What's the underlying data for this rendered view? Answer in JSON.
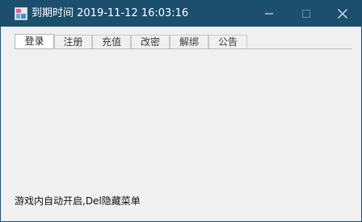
{
  "window": {
    "title": "到期时间 2019-11-12 16:03:16",
    "titlebar_color": "#1c4f6e"
  },
  "icons": {
    "app": "app-icon",
    "minimize": "minimize-icon",
    "maximize": "maximize-icon",
    "close": "close-icon"
  },
  "tabs": [
    {
      "label": "登录",
      "active": true
    },
    {
      "label": "注册",
      "active": false
    },
    {
      "label": "充值",
      "active": false
    },
    {
      "label": "改密",
      "active": false
    },
    {
      "label": "解绑",
      "active": false
    },
    {
      "label": "公告",
      "active": false
    }
  ],
  "status_text": "游戏内自动开启,Del隐藏菜单"
}
